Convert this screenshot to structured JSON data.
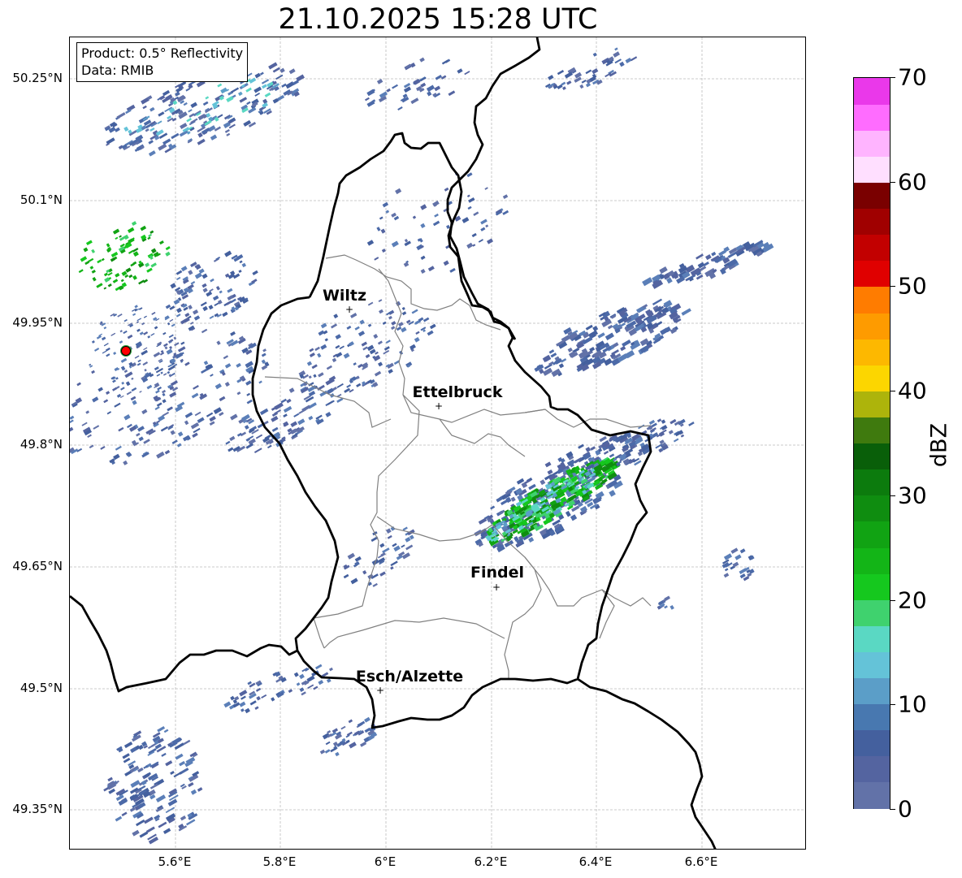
{
  "title": "21.10.2025 15:28 UTC",
  "info_box": {
    "line1": "Product: 0.5° Reflectivity",
    "line2": "Data: RMIB"
  },
  "axes": {
    "lat_labels": [
      "50.25°N",
      "50.1°N",
      "49.95°N",
      "49.8°N",
      "49.65°N",
      "49.5°N",
      "49.35°N"
    ],
    "lon_labels": [
      "5.6°E",
      "5.8°E",
      "6°E",
      "6.2°E",
      "6.4°E",
      "6.6°E"
    ]
  },
  "cities": [
    {
      "name": "Wiltz"
    },
    {
      "name": "Ettelbruck"
    },
    {
      "name": "Findel"
    },
    {
      "name": "Esch/Alzette"
    }
  ],
  "radar_site": {
    "color": "#ff0000"
  },
  "colorbar": {
    "label": "dBZ",
    "min": 0,
    "max": 70,
    "ticks": [
      "0",
      "10",
      "20",
      "30",
      "40",
      "50",
      "60",
      "70"
    ],
    "colors": [
      "#6272a8",
      "#5464a0",
      "#44609e",
      "#4878b0",
      "#5b9ec8",
      "#64c3d8",
      "#5ad8c3",
      "#3fd26e",
      "#15c81e",
      "#13b517",
      "#11a313",
      "#0f8d10",
      "#0c7b0d",
      "#095f09",
      "#3f7a0e",
      "#adb40b",
      "#fcd600",
      "#fdb800",
      "#fe9b00",
      "#ff7c00",
      "#e00000",
      "#c20000",
      "#a00000",
      "#7a0000",
      "#ffdfff",
      "#ffb4ff",
      "#ff6cff",
      "#ea38ea"
    ]
  }
}
